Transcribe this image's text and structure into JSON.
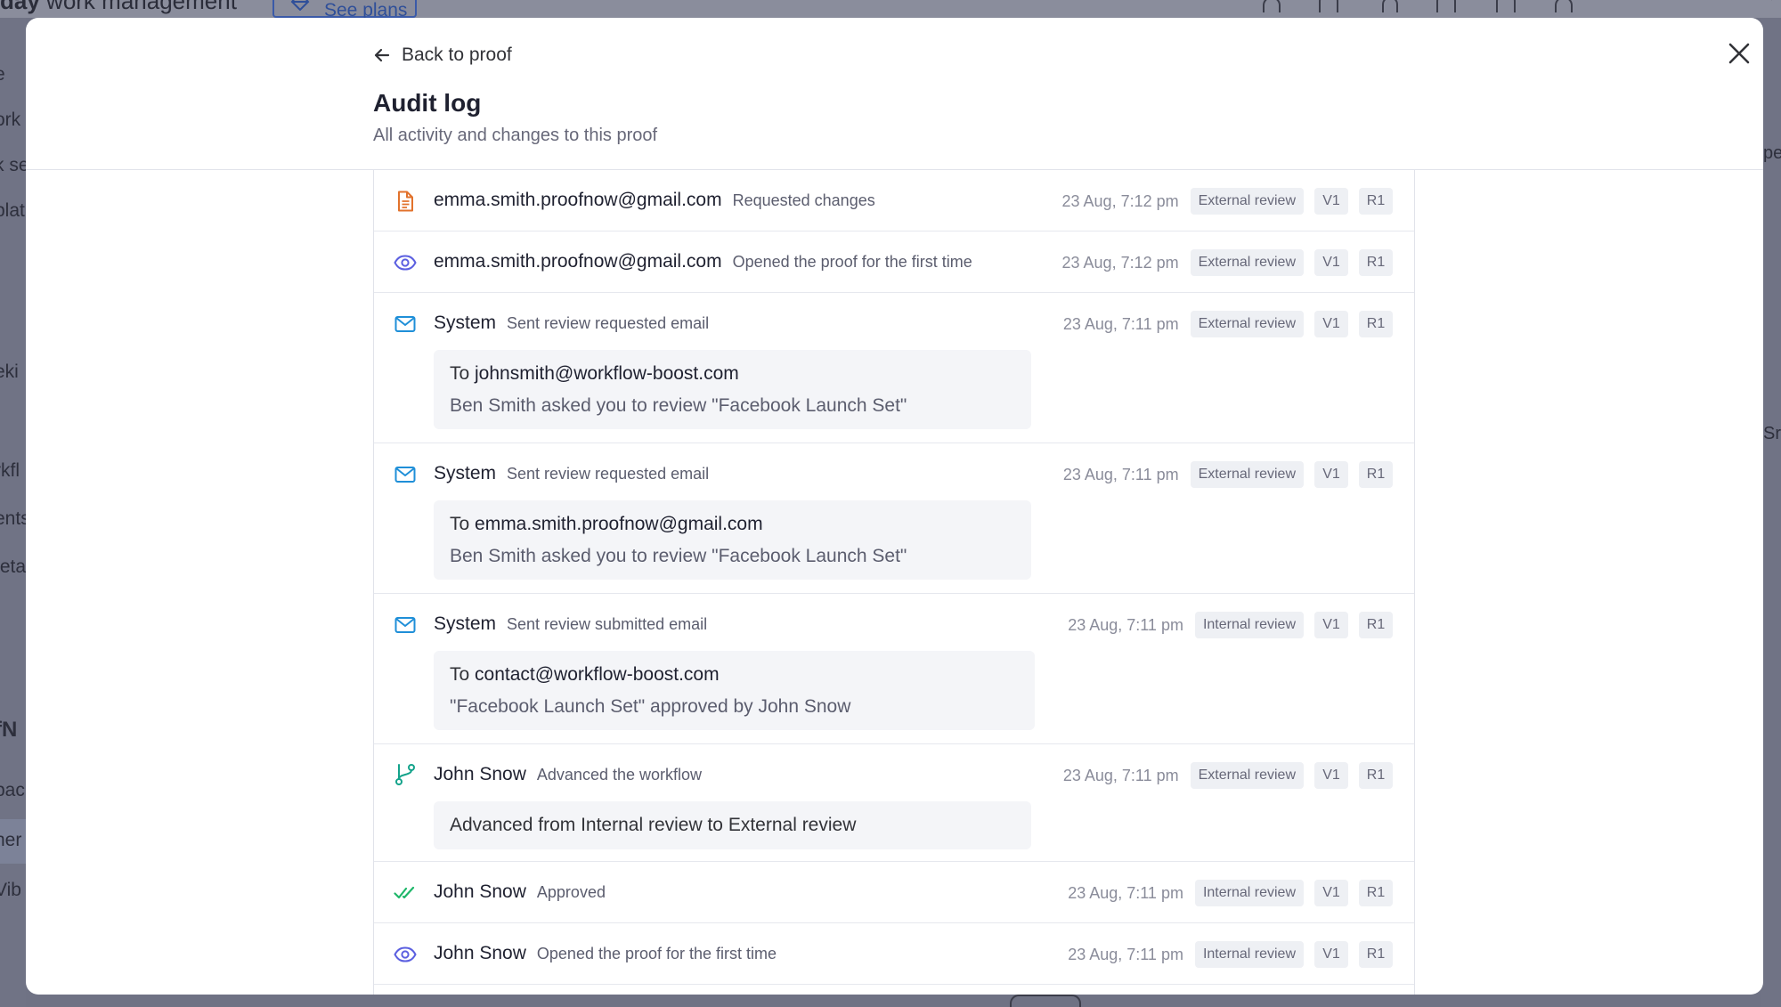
{
  "background": {
    "brand_bold": "day",
    "brand_rest": " work management",
    "see_plans": "See plans",
    "sidebar_fragments": [
      "e",
      "ork",
      "k se",
      "plat",
      "eki",
      "rkfl",
      "ents",
      "teta",
      "fN",
      "pac",
      "ner",
      "Vib"
    ],
    "right_fragments": [
      "pe",
      "Sr"
    ]
  },
  "modal": {
    "back_label": "Back to proof",
    "title": "Audit log",
    "subtitle": "All activity and changes to this proof"
  },
  "entries": [
    {
      "icon": "document-icon",
      "actor": "emma.smith.proofnow@gmail.com",
      "action": "Requested changes",
      "time": "23 Aug, 7:12 pm",
      "stage": "External review",
      "version": "V1",
      "round": "R1"
    },
    {
      "icon": "eye-icon",
      "actor": "emma.smith.proofnow@gmail.com",
      "action": "Opened the proof for the first time",
      "time": "23 Aug, 7:12 pm",
      "stage": "External review",
      "version": "V1",
      "round": "R1"
    },
    {
      "icon": "mail-icon",
      "actor": "System",
      "action": "Sent review requested email",
      "time": "23 Aug, 7:11 pm",
      "stage": "External review",
      "version": "V1",
      "round": "R1",
      "detail_to_prefix": "To ",
      "detail_to": "johnsmith@workflow-boost.com",
      "detail_text": "Ben Smith asked you to review \"Facebook Launch Set\""
    },
    {
      "icon": "mail-icon",
      "actor": "System",
      "action": "Sent review requested email",
      "time": "23 Aug, 7:11 pm",
      "stage": "External review",
      "version": "V1",
      "round": "R1",
      "detail_to_prefix": "To ",
      "detail_to": "emma.smith.proofnow@gmail.com",
      "detail_text": "Ben Smith asked you to review \"Facebook Launch Set\""
    },
    {
      "icon": "mail-icon",
      "actor": "System",
      "action": "Sent review submitted email",
      "time": "23 Aug, 7:11 pm",
      "stage": "Internal review",
      "version": "V1",
      "round": "R1",
      "detail_to_prefix": "To ",
      "detail_to": "contact@workflow-boost.com",
      "detail_text": "\"Facebook Launch Set\" approved by John Snow"
    },
    {
      "icon": "branch-icon",
      "actor": "John Snow",
      "action": "Advanced the workflow",
      "time": "23 Aug, 7:11 pm",
      "stage": "External review",
      "version": "V1",
      "round": "R1",
      "detail_single": "Advanced from Internal review to External review"
    },
    {
      "icon": "double-check-icon",
      "actor": "John Snow",
      "action": "Approved",
      "time": "23 Aug, 7:11 pm",
      "stage": "Internal review",
      "version": "V1",
      "round": "R1"
    },
    {
      "icon": "eye-icon",
      "actor": "John Snow",
      "action": "Opened the proof for the first time",
      "time": "23 Aug, 7:11 pm",
      "stage": "Internal review",
      "version": "V1",
      "round": "R1"
    }
  ],
  "colors": {
    "document": "#e2722c",
    "eye": "#5b5fe0",
    "mail": "#1f8fd8",
    "branch": "#14a38b",
    "check": "#1fb76a"
  }
}
